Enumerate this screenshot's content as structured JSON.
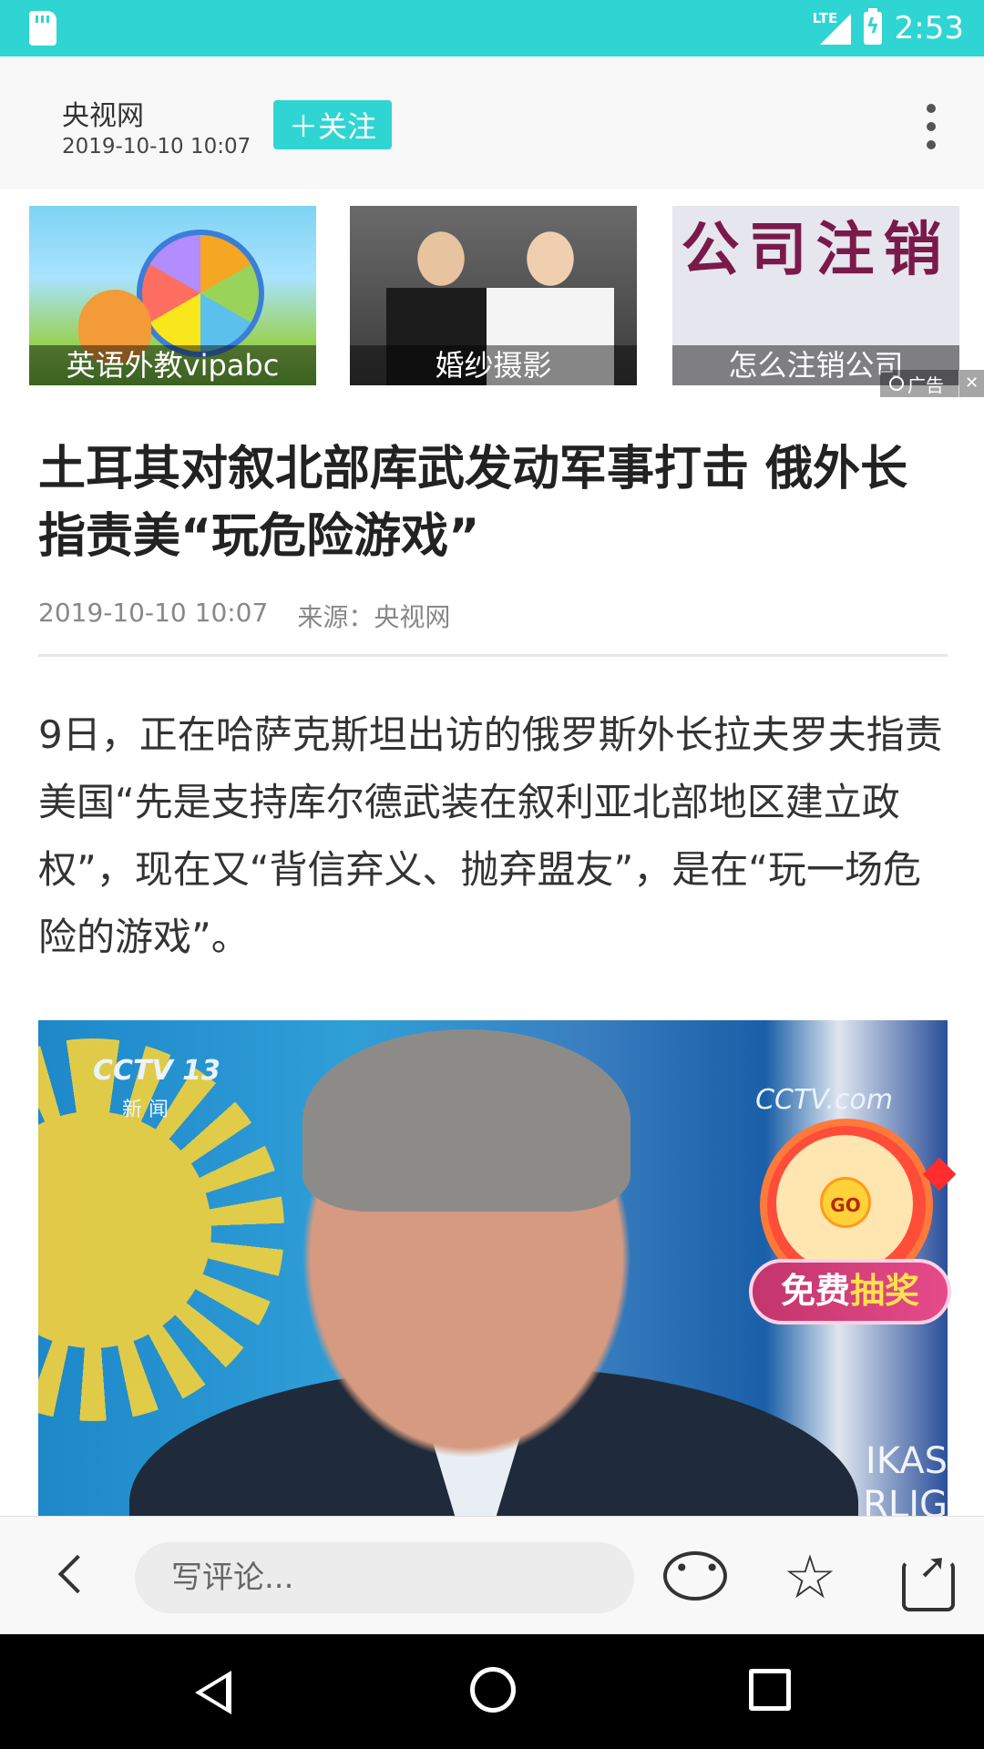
{
  "status_bar": {
    "network": "LTE",
    "time": "2:53",
    "icons": [
      "sd-card-icon",
      "signal-icon",
      "battery-charging-icon"
    ]
  },
  "header": {
    "source_name": "央视网",
    "publish_time": "2019-10-10 10:07",
    "follow_label": "＋关注",
    "more_icon": "more-vertical-icon"
  },
  "ads": {
    "items": [
      {
        "caption": "英语外教vipabc"
      },
      {
        "caption": "婚纱摄影"
      },
      {
        "caption": "怎么注销公司",
        "image_text": "公司注销"
      }
    ],
    "ad_label": "广告",
    "close_glyph": "✕"
  },
  "article": {
    "title": "土耳其对叙北部库武发动军事打击 俄外长指责美“玩危险游戏”",
    "meta_time": "2019-10-10 10:07",
    "meta_source": "来源：央视网",
    "body": "9日，正在哈萨克斯坦出访的俄罗斯外长拉夫罗夫指责美国“先是支持库尔德武装在叙利亚北部地区建立政权”，现在又“背信弃义、抛弃盟友”，是在“玩一场危险的游戏”。",
    "photo": {
      "watermark_left": "CCTV 13",
      "watermark_left_sub": "新 闻",
      "watermark_right": "CCTV.com",
      "background_text": "IKAS\nRLIG"
    }
  },
  "lottery": {
    "go_label": "GO",
    "banner_part1": "免费",
    "banner_part2": "抽奖"
  },
  "comment_bar": {
    "placeholder": "写评论...",
    "icons": [
      "back-arrow-icon",
      "comment-icon",
      "star-icon",
      "share-icon"
    ],
    "star_glyph": "☆"
  },
  "colors": {
    "accent": "#2fd5d3",
    "header_bg": "#f8f8f8",
    "nav_bg": "#000000"
  }
}
